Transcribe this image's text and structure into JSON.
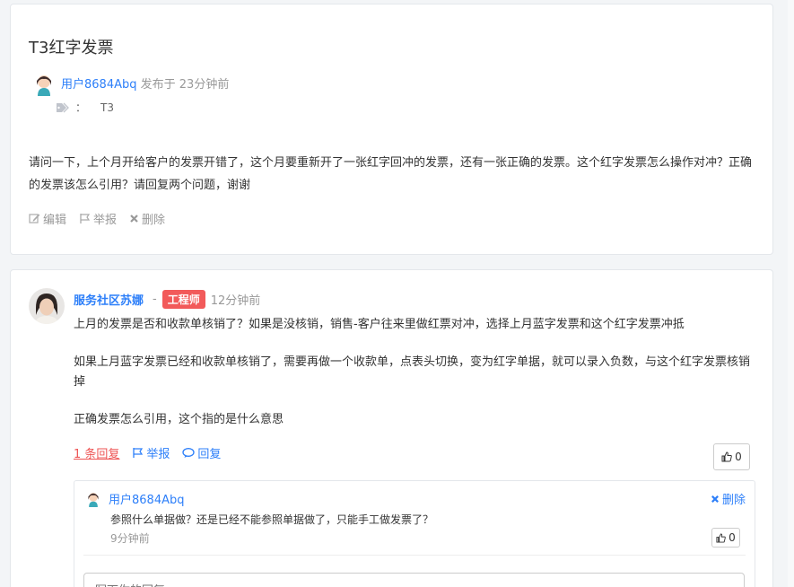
{
  "question": {
    "title": "T3红字发票",
    "author": "用户8684Abq",
    "published_prefix": "发布于",
    "published_time": "23分钟前",
    "tag_colon": "：",
    "tag": "T3",
    "body": "请问一下，上个月开给客户的发票开错了，这个月要重新开了一张红字回冲的发票，还有一张正确的发票。这个红字发票怎么操作对冲？正确的发票该怎么引用？请回复两个问题，谢谢",
    "actions": {
      "edit": "编辑",
      "report": "举报",
      "delete": "删除"
    }
  },
  "answer": {
    "author": "服务社区苏娜",
    "separator": "-",
    "badge": "工程师",
    "time": "12分钟前",
    "paragraphs": [
      "上月的发票是否和收款单核销了？如果是没核销，销售-客户往来里做红票对冲，选择上月蓝字发票和这个红字发票冲抵",
      "如果上月蓝字发票已经和收款单核销了，需要再做一个收款单，点表头切换，变为红字单据，就可以录入负数，与这个红字发票核销掉",
      "正确发票怎么引用，这个指的是什么意思"
    ],
    "actions": {
      "replies": "1 条回复",
      "report": "举报",
      "reply": "回复"
    },
    "likes": "0",
    "reply": {
      "author": "用户8684Abq",
      "delete": "删除",
      "text": "参照什么单据做？还是已经不能参照单据做了，只能手工做发票了？",
      "time": "9分钟前",
      "likes": "0",
      "input_placeholder": "写下你的回复..."
    }
  }
}
